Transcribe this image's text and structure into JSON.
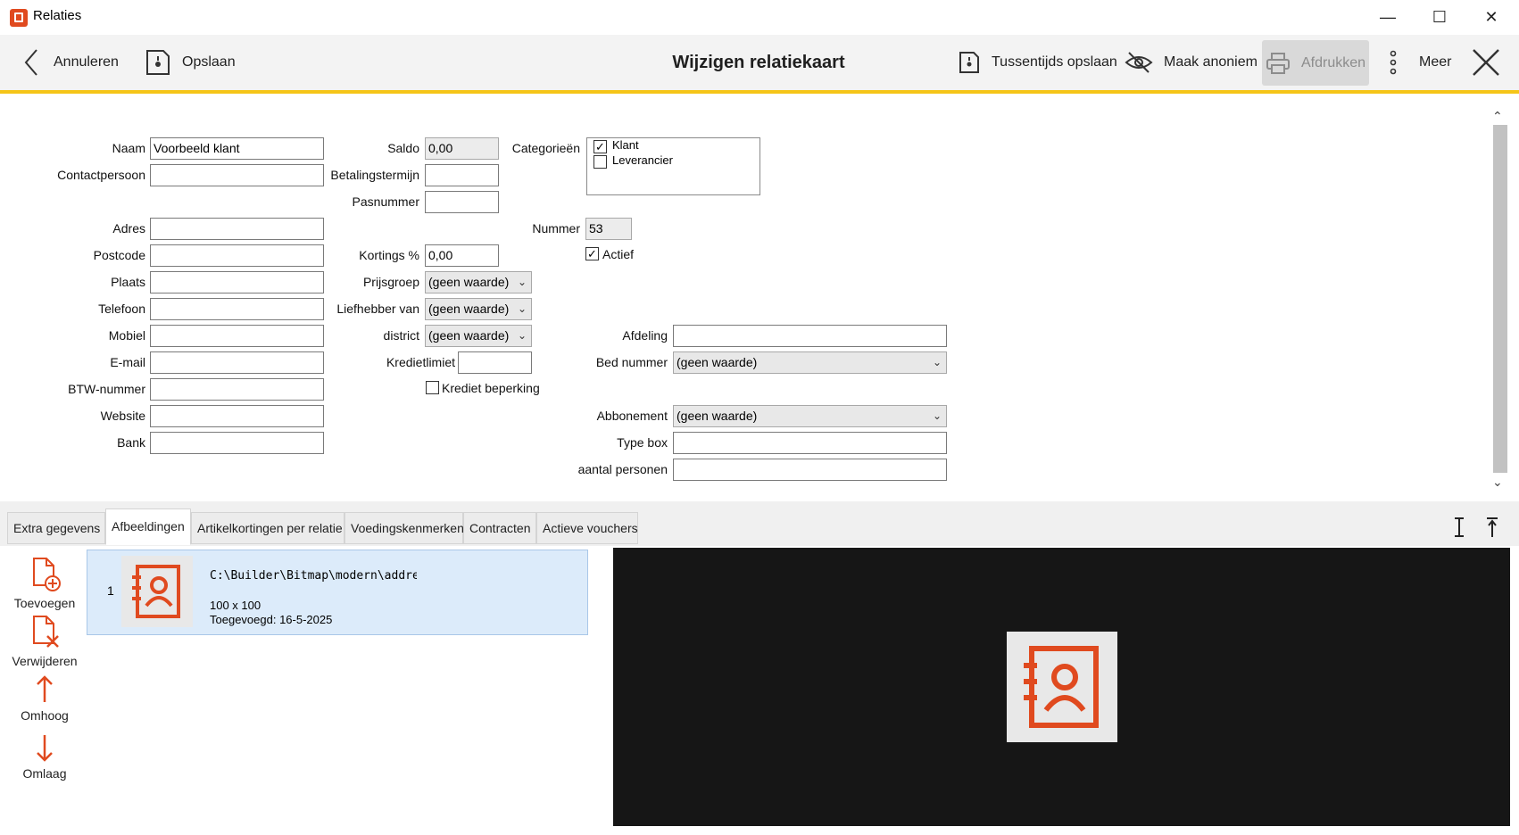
{
  "window": {
    "title": "Relaties"
  },
  "toolbar": {
    "cancel_label": "Annuleren",
    "save_label": "Opslaan",
    "title": "Wijzigen relatiekaart",
    "interim_save_label": "Tussentijds opslaan",
    "anonymize_label": "Maak anoniem",
    "print_label": "Afdrukken",
    "more_label": "Meer"
  },
  "form": {
    "left": [
      {
        "label": "Naam",
        "value": "Voorbeeld klant"
      },
      {
        "label": "Contactpersoon",
        "value": ""
      },
      {
        "label": "Adres",
        "value": ""
      },
      {
        "label": "Postcode",
        "value": ""
      },
      {
        "label": "Plaats",
        "value": ""
      },
      {
        "label": "Telefoon",
        "value": ""
      },
      {
        "label": "Mobiel",
        "value": ""
      },
      {
        "label": "E-mail",
        "value": ""
      },
      {
        "label": "BTW-nummer",
        "value": ""
      },
      {
        "label": "Website",
        "value": ""
      },
      {
        "label": "Bank",
        "value": ""
      }
    ],
    "saldo": {
      "label": "Saldo",
      "value": "0,00"
    },
    "betalingstermijn": {
      "label": "Betalingstermijn",
      "value": ""
    },
    "pasnummer": {
      "label": "Pasnummer",
      "value": ""
    },
    "kortings": {
      "label": "Kortings %",
      "value": "0,00"
    },
    "prijsgroep": {
      "label": "Prijsgroep",
      "value": "(geen waarde)"
    },
    "liefhebber": {
      "label": "Liefhebber van",
      "value": "(geen waarde)"
    },
    "district": {
      "label": "district",
      "value": "(geen waarde)"
    },
    "kredietlimiet": {
      "label": "Kredietlimiet",
      "value": ""
    },
    "krediet_beperking": {
      "label": "Krediet beperking",
      "checked": false
    },
    "categorieen": {
      "label": "Categorieën",
      "options": [
        {
          "label": "Klant",
          "checked": true
        },
        {
          "label": "Leverancier",
          "checked": false
        }
      ]
    },
    "nummer": {
      "label": "Nummer",
      "value": "53"
    },
    "actief": {
      "label": "Actief",
      "checked": true
    },
    "afdeling": {
      "label": "Afdeling",
      "value": ""
    },
    "bed_nummer": {
      "label": "Bed nummer",
      "value": "(geen waarde)"
    },
    "abbonement": {
      "label": "Abbonement",
      "value": "(geen waarde)"
    },
    "type_box": {
      "label": "Type box",
      "value": ""
    },
    "aantal_personen": {
      "label": "aantal personen",
      "value": ""
    }
  },
  "tabs": [
    {
      "label": "Extra gegevens",
      "active": false
    },
    {
      "label": "Afbeeldingen",
      "active": true
    },
    {
      "label": "Artikelkortingen per relatie",
      "active": false
    },
    {
      "label": "Voedingskenmerken",
      "active": false
    },
    {
      "label": "Contracten",
      "active": false
    },
    {
      "label": "Actieve vouchers",
      "active": false
    }
  ],
  "side_actions": {
    "add": "Toevoegen",
    "remove": "Verwijderen",
    "up": "Omhoog",
    "down": "Omlaag"
  },
  "images": [
    {
      "index": "1",
      "path": "C:\\Builder\\Bitmap\\modern\\address_boo",
      "size": "100 x 100",
      "added": "Toegevoegd: 16-5-2025"
    }
  ],
  "colors": {
    "accent": "#e04a1f",
    "toolbar_underline": "#f5c518",
    "selection": "#dcebfa"
  }
}
